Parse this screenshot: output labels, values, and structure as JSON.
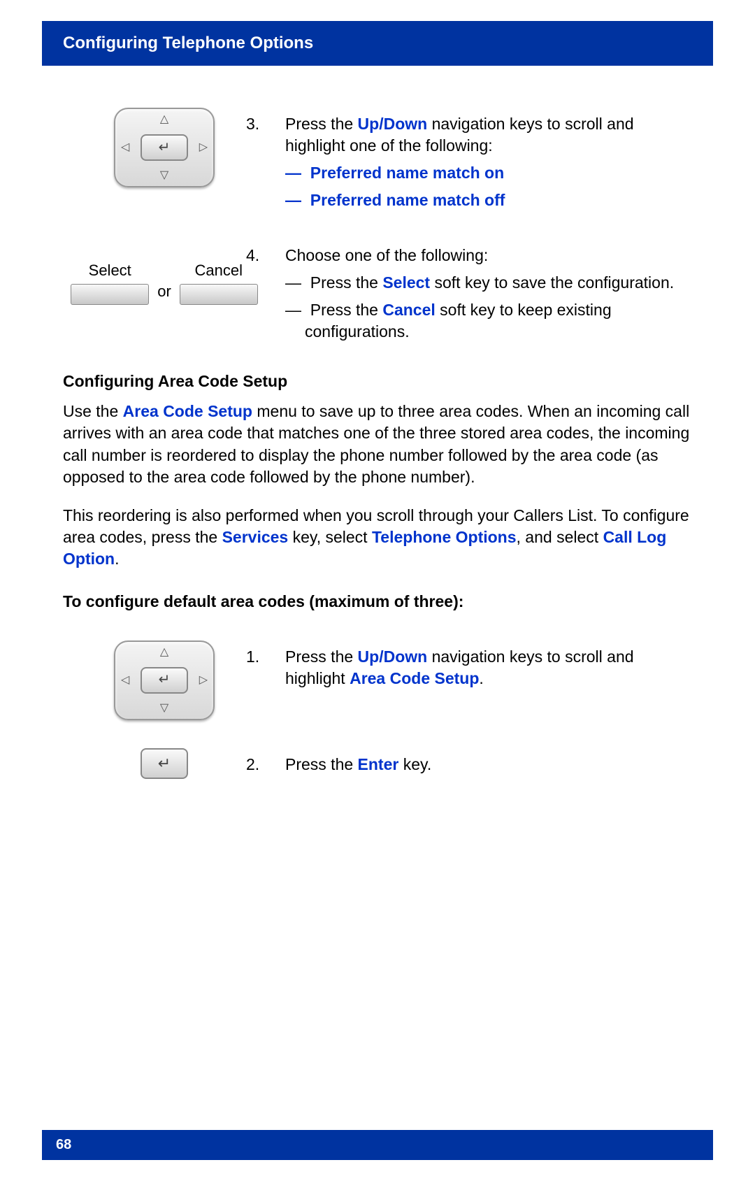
{
  "header": {
    "title": "Configuring Telephone Options"
  },
  "step3": {
    "number": "3.",
    "text_pre": "Press the ",
    "updown": "Up/Down",
    "text_post": " navigation keys to scroll and highlight one of the following:",
    "opt1_dash": "—",
    "opt1": "Preferred name match on",
    "opt2_dash": "—",
    "opt2": "Preferred name match off"
  },
  "softkeys": {
    "select": "Select",
    "or": "or",
    "cancel": "Cancel"
  },
  "step4": {
    "number": "4.",
    "intro": "Choose one of the following:",
    "sub1_dash": "—",
    "sub1_pre": "Press the ",
    "sub1_key": "Select",
    "sub1_post": " soft key to save the configuration.",
    "sub2_dash": "—",
    "sub2_pre": "Press the ",
    "sub2_key": "Cancel",
    "sub2_post": " soft key to keep existing configurations."
  },
  "section": {
    "heading": "Configuring Area Code Setup",
    "p1_pre": "Use the ",
    "p1_key": "Area Code Setup",
    "p1_post": " menu to save up to three area codes. When an incoming call arrives with an area code that matches one of the three stored area codes, the incoming call number is reordered to display the phone number followed by the area code (as opposed to the area code followed by the phone number).",
    "p2_pre": "This reordering is also performed when you scroll through your Callers List. To configure area codes, press the ",
    "p2_k1": "Services",
    "p2_mid1": " key, select ",
    "p2_k2": "Telephone Options",
    "p2_mid2": ", and select ",
    "p2_k3": "Call Log Option",
    "p2_post": ".",
    "subheading": "To configure default area codes (maximum of three):"
  },
  "step1b": {
    "number": "1.",
    "pre": "Press the ",
    "updown": "Up/Down",
    "mid": " navigation keys to scroll and highlight ",
    "key": "Area Code Setup",
    "post": "."
  },
  "step2b": {
    "number": "2.",
    "pre": "Press the ",
    "key": "Enter",
    "post": " key."
  },
  "footer": {
    "page": "68"
  }
}
